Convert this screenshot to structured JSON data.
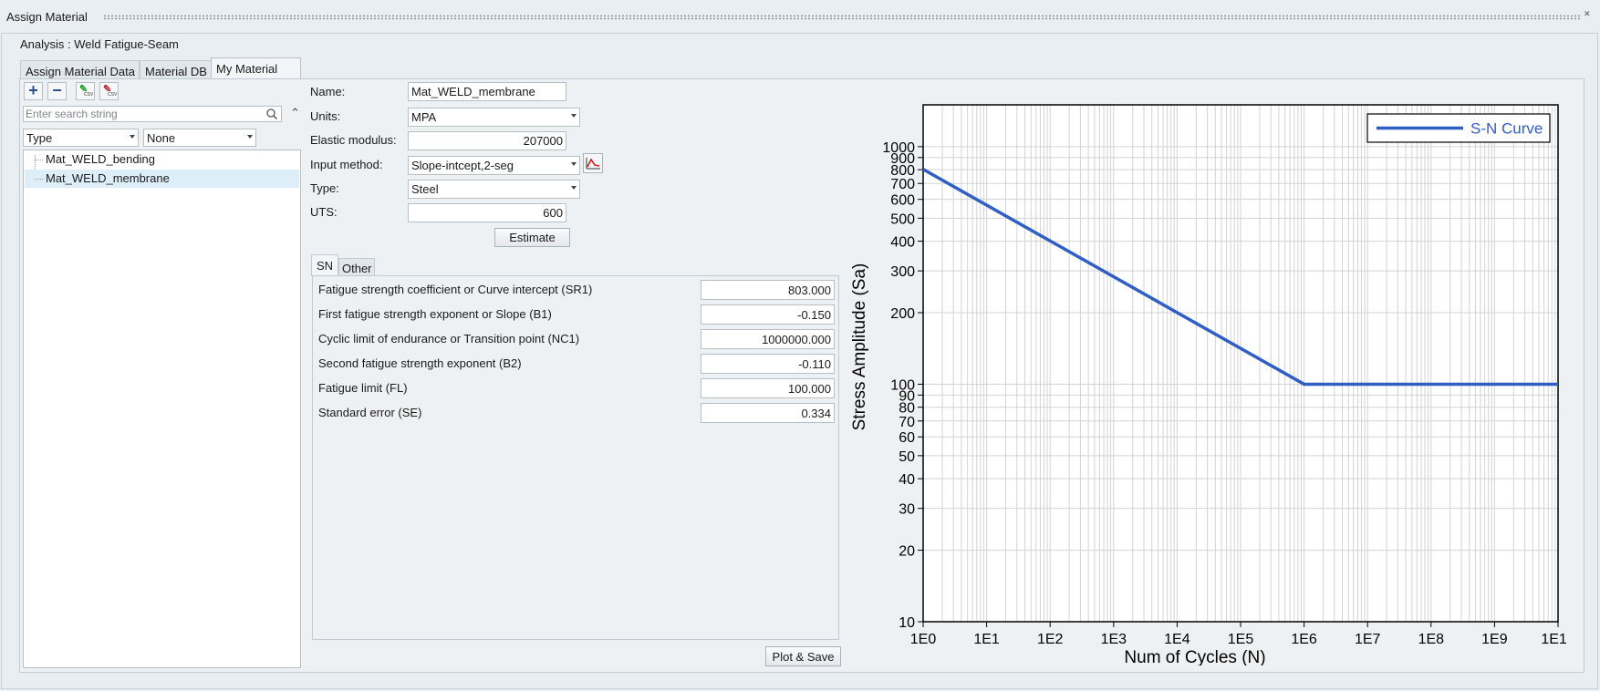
{
  "window": {
    "title": "Assign Material",
    "close_glyph": "✕"
  },
  "analysis_label": "Analysis : Weld Fatigue-Seam",
  "tabs": [
    {
      "label": "Assign Material Data"
    },
    {
      "label": "Material DB"
    },
    {
      "label": "My Material"
    }
  ],
  "toolbar": {
    "add_glyph": "+",
    "remove_glyph": "−",
    "csv_text": "CSV"
  },
  "search": {
    "placeholder": "Enter search string",
    "collapse_glyph": "⌃"
  },
  "filters": {
    "type": "Type",
    "group": "None"
  },
  "tree": {
    "items": [
      {
        "label": "Mat_WELD_bending"
      },
      {
        "label": "Mat_WELD_membrane",
        "selected": true
      }
    ]
  },
  "form": {
    "name_label": "Name:",
    "name_value": "Mat_WELD_membrane",
    "units_label": "Units:",
    "units_value": "MPA",
    "elastic_label": "Elastic modulus:",
    "elastic_value": "207000",
    "input_method_label": "Input method:",
    "input_method_value": "Slope-intcept,2-seg",
    "type_label": "Type:",
    "type_value": "Steel",
    "uts_label": "UTS:",
    "uts_value": "600",
    "estimate_label": "Estimate"
  },
  "subtabs": [
    {
      "label": "SN"
    },
    {
      "label": "Other"
    }
  ],
  "params": [
    {
      "label": "Fatigue strength coefficient or Curve intercept (SR1)",
      "value": "803.000"
    },
    {
      "label": "First fatigue strength exponent or Slope (B1)",
      "value": "-0.150"
    },
    {
      "label": "Cyclic limit of endurance or Transition point (NC1)",
      "value": "1000000.000"
    },
    {
      "label": "Second fatigue strength exponent (B2)",
      "value": "-0.110"
    },
    {
      "label": "Fatigue limit (FL)",
      "value": "100.000"
    },
    {
      "label": "Standard error (SE)",
      "value": "0.334"
    }
  ],
  "plot_save_label": "Plot & Save",
  "colors": {
    "curve": "#2f5fc4",
    "grid": "#d3d3d3",
    "background": "#e9eef2"
  },
  "icons": {
    "search": "search-icon",
    "import_csv": "import-csv-icon",
    "export_csv": "export-csv-icon",
    "plot": "plot-icon",
    "close": "close-icon"
  },
  "chart_data": {
    "type": "line",
    "title": "",
    "xlabel": "Num of Cycles (N)",
    "ylabel": "Stress Amplitude (Sa)",
    "xscale": "log",
    "yscale": "log",
    "xlim": [
      1,
      10000000000
    ],
    "ylim": [
      10,
      1500
    ],
    "xticks": [
      "1E0",
      "1E1",
      "1E2",
      "1E3",
      "1E4",
      "1E5",
      "1E6",
      "1E7",
      "1E8",
      "1E9",
      "1E10"
    ],
    "yticks": [
      "10",
      "20",
      "30",
      "40",
      "50",
      "60",
      "70",
      "80",
      "90",
      "100",
      "200",
      "300",
      "400",
      "500",
      "600",
      "700",
      "800",
      "900",
      "1000"
    ],
    "grid": true,
    "legend": "top-right",
    "series": [
      {
        "name": "S-N Curve",
        "x": [
          1,
          1000000,
          10000000000
        ],
        "y": [
          803,
          100,
          100
        ]
      }
    ]
  }
}
